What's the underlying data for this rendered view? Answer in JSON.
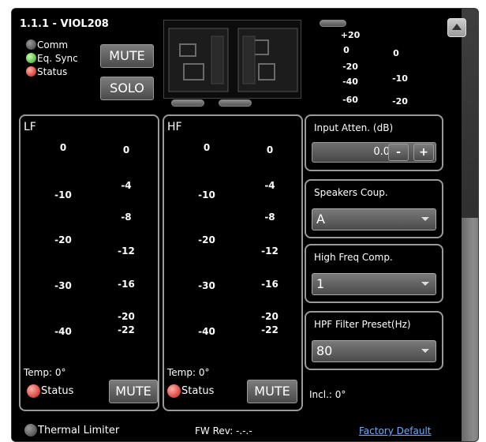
{
  "header": {
    "title": "1.1.1 - VIOL208"
  },
  "indicators": {
    "comm": "Comm",
    "eq_sync": "Eq. Sync",
    "status": "Status"
  },
  "buttons": {
    "mute": "MUTE",
    "solo": "SOLO"
  },
  "top_meter": {
    "left_ticks": [
      "+20",
      "0",
      "-20",
      "-40",
      "-60"
    ],
    "right_ticks": [
      "0",
      "-10",
      "-20"
    ]
  },
  "lf": {
    "title": "LF",
    "left_ticks": [
      "0",
      "-10",
      "-20",
      "-30",
      "-40"
    ],
    "right_ticks": [
      "0",
      "-4",
      "-8",
      "-12",
      "-16",
      "-20",
      "-22"
    ],
    "temp": "Temp: 0°",
    "status": "Status",
    "mute": "MUTE"
  },
  "hf": {
    "title": "HF",
    "left_ticks": [
      "0",
      "-10",
      "-20",
      "-30",
      "-40"
    ],
    "right_ticks": [
      "0",
      "-4",
      "-8",
      "-12",
      "-16",
      "-20",
      "-22"
    ],
    "temp": "Temp: 0°",
    "status": "Status",
    "mute": "MUTE"
  },
  "input_atten": {
    "label": "Input Atten. (dB)",
    "value": "0.0",
    "minus": "-",
    "plus": "+"
  },
  "speakers_coup": {
    "label": "Speakers Coup.",
    "value": "A"
  },
  "high_freq_comp": {
    "label": "High Freq Comp.",
    "value": "1"
  },
  "hpf_preset": {
    "label": "HPF Filter Preset(Hz)",
    "value": "80"
  },
  "incl": "Incl.: 0°",
  "footer": {
    "thermal_limiter": "Thermal Limiter",
    "fw_rev": "FW Rev: -.-.-",
    "factory_default": "Factory Default"
  },
  "colors": {
    "led_green": "#2f9a20",
    "led_red": "#c8120c",
    "link": "#6aaeff"
  }
}
